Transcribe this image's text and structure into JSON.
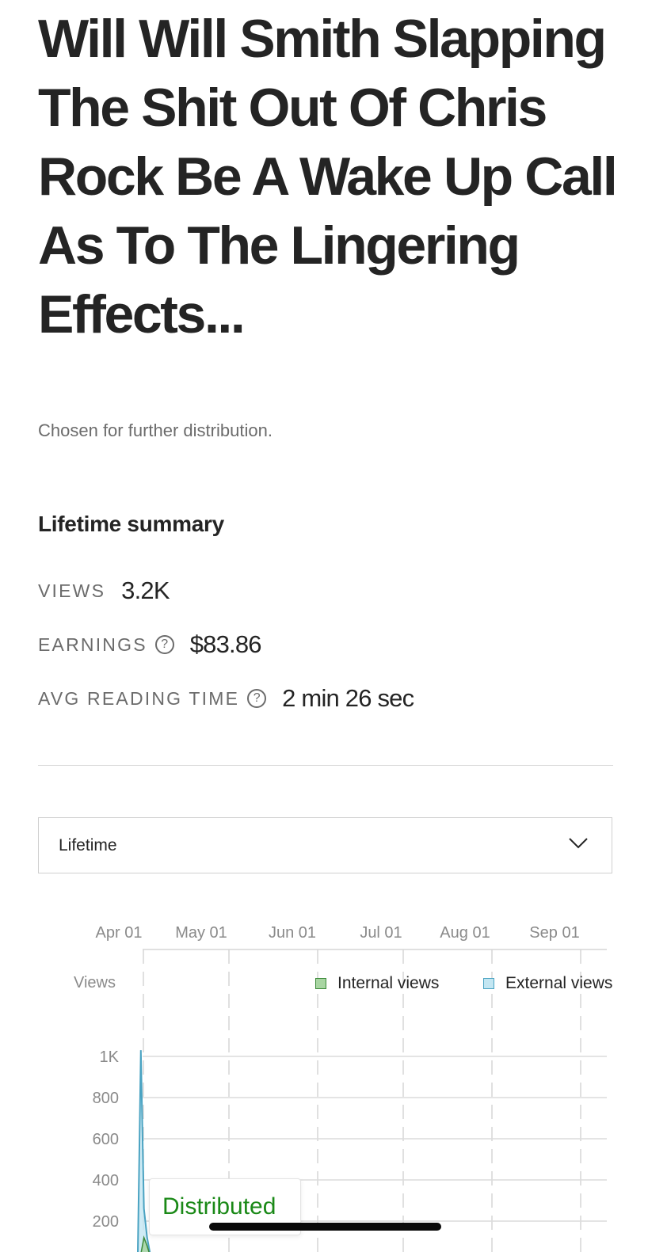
{
  "story": {
    "title": "Will Will Smith Slapping The Shit Out Of Chris Rock Be A Wake Up Call As To The Lingering Effects...",
    "status": "Chosen for further distribution."
  },
  "summary": {
    "heading": "Lifetime summary",
    "stats": [
      {
        "label": "VIEWS",
        "value": "3.2K",
        "has_help": false
      },
      {
        "label": "EARNINGS",
        "value": "$83.86",
        "has_help": true
      },
      {
        "label": "AVG READING TIME",
        "value": "2 min 26 sec",
        "has_help": true
      }
    ],
    "help_icon": "question-circle-icon"
  },
  "range_select": {
    "value": "Lifetime",
    "icon": "chevron-down-icon"
  },
  "chart_data": {
    "type": "area",
    "x_ticks": [
      "Apr 01",
      "May 01",
      "Jun 01",
      "Jul 01",
      "Aug 01",
      "Sep 01"
    ],
    "y_label": "Views",
    "y_ticks": [
      "200",
      "400",
      "600",
      "800",
      "1K"
    ],
    "ylim": [
      0,
      1000
    ],
    "grid": true,
    "legend_position": "top-right",
    "series": [
      {
        "name": "Internal views",
        "color": "#a8d5a2",
        "stroke": "#3c8a3a",
        "x": [
          "Mar 30",
          "Mar 31",
          "Apr 01",
          "Apr 02",
          "Apr 03",
          "Apr 04"
        ],
        "values": [
          0,
          40,
          120,
          80,
          30,
          5
        ]
      },
      {
        "name": "External views",
        "color": "#c3e6f2",
        "stroke": "#4aa3c2",
        "x": [
          "Mar 30",
          "Mar 31",
          "Apr 01",
          "Apr 02",
          "Apr 03",
          "Apr 04"
        ],
        "values": [
          0,
          1030,
          260,
          120,
          40,
          10
        ]
      }
    ],
    "annotation": "Distributed"
  },
  "colors": {
    "text": "#242424",
    "muted": "#6b6b6b",
    "accent_green": "#1a8917"
  }
}
